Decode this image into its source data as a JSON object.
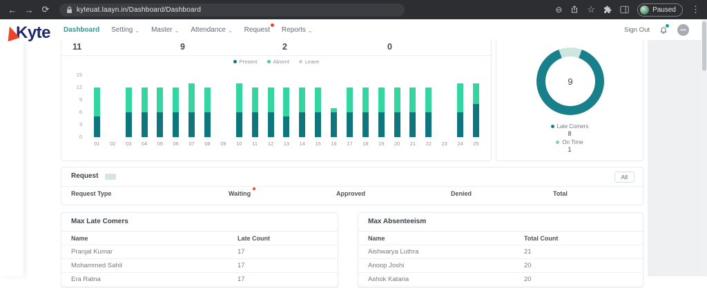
{
  "browser": {
    "url": "kyteuat.laayn.in/Dashboard/Dashboard",
    "profile_label": "Paused",
    "icons": {
      "back": "←",
      "forward": "→",
      "refresh": "⟳",
      "zoom_out": "⊖",
      "star": "☆",
      "more": "⋮"
    }
  },
  "header": {
    "logo": "Kyte",
    "caret_icon": "⌄",
    "avatar_icon": "•••",
    "sign_out": "Sign Out",
    "nav": [
      {
        "label": "Dashboard",
        "active": true,
        "caret": false,
        "dot": false
      },
      {
        "label": "Setting",
        "active": false,
        "caret": true,
        "dot": false
      },
      {
        "label": "Master",
        "active": false,
        "caret": true,
        "dot": false
      },
      {
        "label": "Attendance",
        "active": false,
        "caret": true,
        "dot": false
      },
      {
        "label": "Request",
        "active": false,
        "caret": false,
        "dot": true
      },
      {
        "label": "Reports",
        "active": false,
        "caret": true,
        "dot": false
      }
    ]
  },
  "stats": {
    "values": [
      "11",
      "9",
      "2",
      "0"
    ]
  },
  "chart_data": [
    {
      "type": "bar",
      "stacked": true,
      "categories": [
        "01",
        "02",
        "03",
        "04",
        "05",
        "06",
        "07",
        "08",
        "09",
        "10",
        "11",
        "12",
        "13",
        "14",
        "15",
        "16",
        "17",
        "18",
        "19",
        "20",
        "21",
        "22",
        "23",
        "24",
        "25"
      ],
      "series": [
        {
          "name": "Present",
          "color": "#0e767c",
          "values": [
            5,
            0,
            6,
            6,
            6,
            6,
            6,
            6,
            0,
            6,
            6,
            6,
            5,
            6,
            6,
            6,
            6,
            6,
            6,
            6,
            6,
            6,
            0,
            6,
            8
          ]
        },
        {
          "name": "Absent",
          "color": "#33d6a1",
          "values": [
            7,
            0,
            6,
            6,
            6,
            6,
            7,
            6,
            0,
            7,
            6,
            6,
            7,
            6,
            6,
            1,
            6,
            6,
            6,
            6,
            6,
            6,
            0,
            7,
            5
          ]
        },
        {
          "name": "Leave",
          "color": "#c9ced2",
          "values": [
            0,
            0,
            0,
            0,
            0,
            0,
            0,
            0,
            0,
            0,
            0,
            0,
            0,
            0,
            0,
            0,
            0,
            0,
            0,
            0,
            0,
            0,
            0,
            0,
            0
          ]
        }
      ],
      "ylim": [
        0,
        15
      ],
      "yticks": [
        15,
        12,
        9,
        6,
        3,
        0
      ],
      "legend_position": "top",
      "grid": false
    },
    {
      "type": "pie",
      "donut_center": "9",
      "labels": [
        "Late Comers",
        "On Time"
      ],
      "values": [
        8,
        1
      ],
      "colors": [
        "#17808a",
        "#cfe5df"
      ]
    }
  ],
  "donut": {
    "center": "9",
    "legend": [
      {
        "label": "Late Comers",
        "value": "8",
        "color": "#17808a"
      },
      {
        "label": "On Time",
        "value": "1",
        "color": "#7fccc3"
      }
    ]
  },
  "request_section": {
    "title": "Request",
    "all_label": "All",
    "columns": [
      {
        "label": "Request Type",
        "dot": false
      },
      {
        "label": "Waiting",
        "dot": true
      },
      {
        "label": "Approved",
        "dot": false
      },
      {
        "label": "Denied",
        "dot": false
      },
      {
        "label": "Total",
        "dot": false
      }
    ],
    "rows": []
  },
  "tables": {
    "late_comers": {
      "title": "Max Late Comers",
      "columns": [
        "Name",
        "Late Count"
      ],
      "rows": [
        [
          "Pranjal Kumar",
          "17"
        ],
        [
          "Mohammed Sahil",
          "17"
        ],
        [
          "Era Ratna",
          "17"
        ]
      ]
    },
    "absenteeism": {
      "title": "Max Absenteeism",
      "columns": [
        "Name",
        "Total Count"
      ],
      "rows": [
        [
          "Aishwarya Luthra",
          "21"
        ],
        [
          "Anoop Joshi",
          "20"
        ],
        [
          "Ashok Kataria",
          "20"
        ]
      ]
    }
  }
}
